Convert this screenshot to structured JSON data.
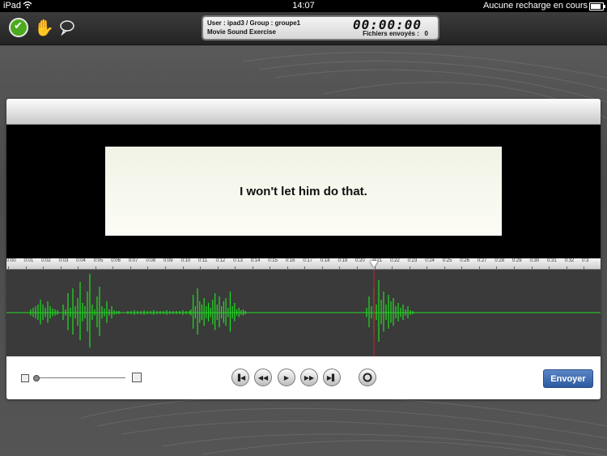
{
  "status_bar": {
    "device": "iPad",
    "time": "14:07",
    "charging": "Aucune recharge en cours"
  },
  "toolbar": {
    "icons": [
      "check-icon",
      "hand-icon",
      "speech-bubble-icon"
    ]
  },
  "info_panel": {
    "user": "User : ipad3 / Group : groupe1",
    "exercise": "Movie Sound Exercise",
    "timer": "00:00:00",
    "files_sent_label": "Fichiers envoyés :",
    "files_sent_count": "0"
  },
  "video": {
    "subtitle": "I won't let him do that."
  },
  "timeline": {
    "ticks": [
      "0:00",
      "0:01",
      "0:02",
      "0:03",
      "0:04",
      "0:05",
      "0:06",
      "0:07",
      "0:08",
      "0:09",
      "0:10",
      "0:11",
      "0:12",
      "0:13",
      "0:14",
      "0:15",
      "0:16",
      "0:17",
      "0:18",
      "0:19",
      "0:20",
      "0:21",
      "0:22",
      "0:23",
      "0:24",
      "0:25",
      "0:26",
      "0:27",
      "0:28",
      "0:29",
      "0:30",
      "0:31",
      "0:32",
      "0:3"
    ],
    "playhead_label": "0:21"
  },
  "controls": {
    "buttons": [
      "skip-to-start",
      "rewind",
      "play",
      "fast-forward",
      "skip-to-end",
      "record"
    ],
    "send_label": "Envoyer"
  },
  "colors": {
    "waveform": "#22dd22",
    "playhead": "#cc2222",
    "send_button": "#3a68b0"
  }
}
